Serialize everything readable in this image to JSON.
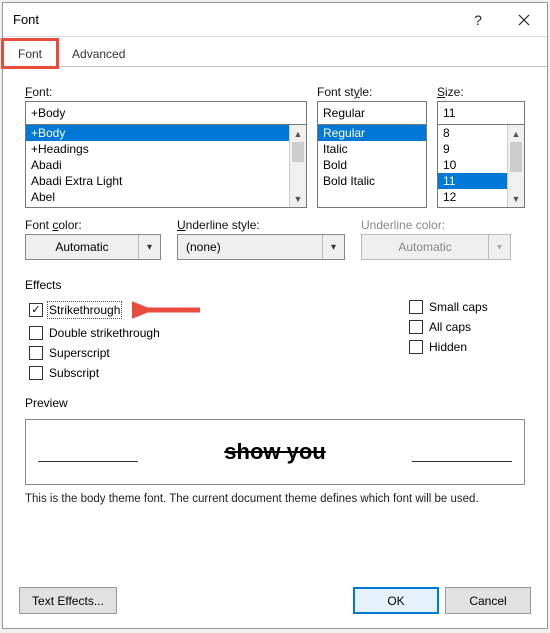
{
  "window": {
    "title": "Font"
  },
  "tabs": {
    "font": "Font",
    "advanced": "Advanced"
  },
  "labels": {
    "font": "Font:",
    "fontStyle": "Font style:",
    "size": "Size:",
    "fontColor": "Font color:",
    "underlineStyle": "Underline style:",
    "underlineColor": "Underline color:",
    "effects": "Effects",
    "preview": "Preview"
  },
  "font": {
    "value": "+Body",
    "list": [
      "+Body",
      "+Headings",
      "Abadi",
      "Abadi Extra Light",
      "Abel"
    ],
    "selectedIndex": 0
  },
  "fontStyle": {
    "value": "Regular",
    "list": [
      "Regular",
      "Italic",
      "Bold",
      "Bold Italic"
    ],
    "selectedIndex": 0
  },
  "size": {
    "value": "11",
    "list": [
      "8",
      "9",
      "10",
      "11",
      "12"
    ],
    "selectedIndex": 3
  },
  "fontColor": {
    "value": "Automatic"
  },
  "underlineStyle": {
    "value": "(none)"
  },
  "underlineColor": {
    "value": "Automatic",
    "disabled": true
  },
  "effects": {
    "strikethrough": {
      "label": "Strikethrough",
      "checked": true
    },
    "doubleStrikethrough": {
      "label": "Double strikethrough",
      "checked": false
    },
    "superscript": {
      "label": "Superscript",
      "checked": false
    },
    "subscript": {
      "label": "Subscript",
      "checked": false
    },
    "smallCaps": {
      "label": "Small caps",
      "checked": false
    },
    "allCaps": {
      "label": "All caps",
      "checked": false
    },
    "hidden": {
      "label": "Hidden",
      "checked": false
    }
  },
  "preview": {
    "text": "show you"
  },
  "description": "This is the body theme font. The current document theme defines which font will be used.",
  "buttons": {
    "textEffects": "Text Effects...",
    "ok": "OK",
    "cancel": "Cancel"
  },
  "annotation": {
    "highlightTab": "font",
    "arrowTarget": "strikethrough"
  }
}
